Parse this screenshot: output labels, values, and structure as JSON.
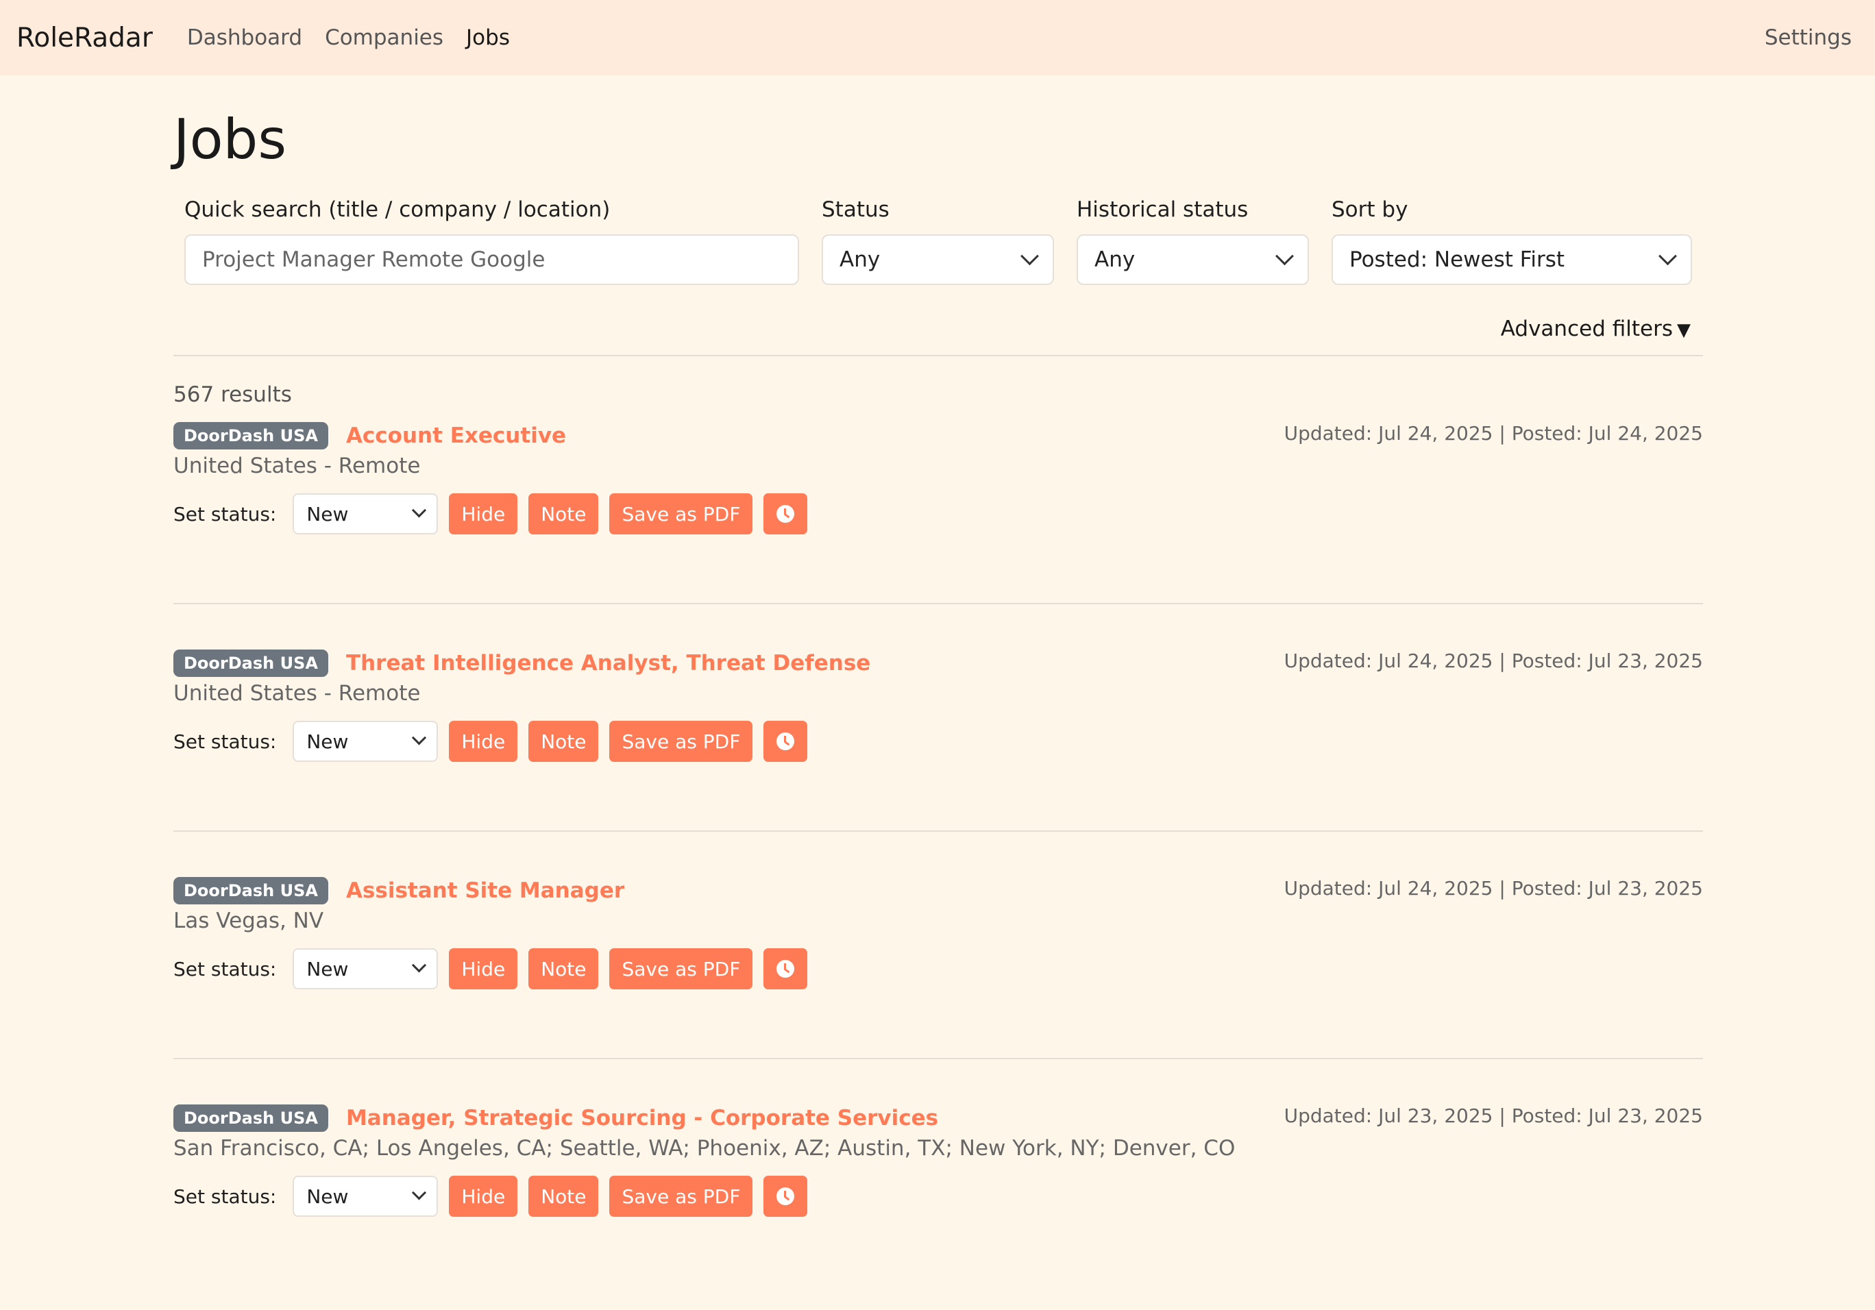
{
  "nav": {
    "brand": "RoleRadar",
    "links": [
      {
        "label": "Dashboard"
      },
      {
        "label": "Companies"
      },
      {
        "label": "Jobs"
      }
    ],
    "settings": "Settings"
  },
  "page": {
    "title": "Jobs"
  },
  "filters": {
    "search_label": "Quick search (title / company / location)",
    "search_placeholder": "Project Manager Remote Google",
    "status_label": "Status",
    "status_value": "Any",
    "historical_label": "Historical status",
    "historical_value": "Any",
    "sort_label": "Sort by",
    "sort_value": "Posted: Newest First",
    "advanced": "Advanced filters",
    "advanced_icon": "▼"
  },
  "results": {
    "count_text": "567 results"
  },
  "actions": {
    "set_status_label": "Set status:",
    "hide": "Hide",
    "note": "Note",
    "pdf": "Save as PDF",
    "history_icon": "clock-icon"
  },
  "jobs": [
    {
      "company": "DoorDash USA",
      "title": "Account Executive",
      "location": "United States - Remote",
      "dates": "Updated: Jul 24, 2025 | Posted: Jul 24, 2025",
      "status": "New"
    },
    {
      "company": "DoorDash USA",
      "title": "Threat Intelligence Analyst, Threat Defense",
      "location": "United States - Remote",
      "dates": "Updated: Jul 24, 2025 | Posted: Jul 23, 2025",
      "status": "New"
    },
    {
      "company": "DoorDash USA",
      "title": "Assistant Site Manager",
      "location": "Las Vegas, NV",
      "dates": "Updated: Jul 24, 2025 | Posted: Jul 23, 2025",
      "status": "New"
    },
    {
      "company": "DoorDash USA",
      "title": "Manager, Strategic Sourcing - Corporate Services",
      "location": "San Francisco, CA; Los Angeles, CA; Seattle, WA; Phoenix, AZ; Austin, TX; New York, NY; Denver, CO",
      "dates": "Updated: Jul 23, 2025 | Posted: Jul 23, 2025",
      "status": "New"
    }
  ],
  "colors": {
    "accent": "#ff7b55",
    "badge": "#6c757d",
    "navbar": "#ffebdb",
    "background": "#fff6ea"
  }
}
